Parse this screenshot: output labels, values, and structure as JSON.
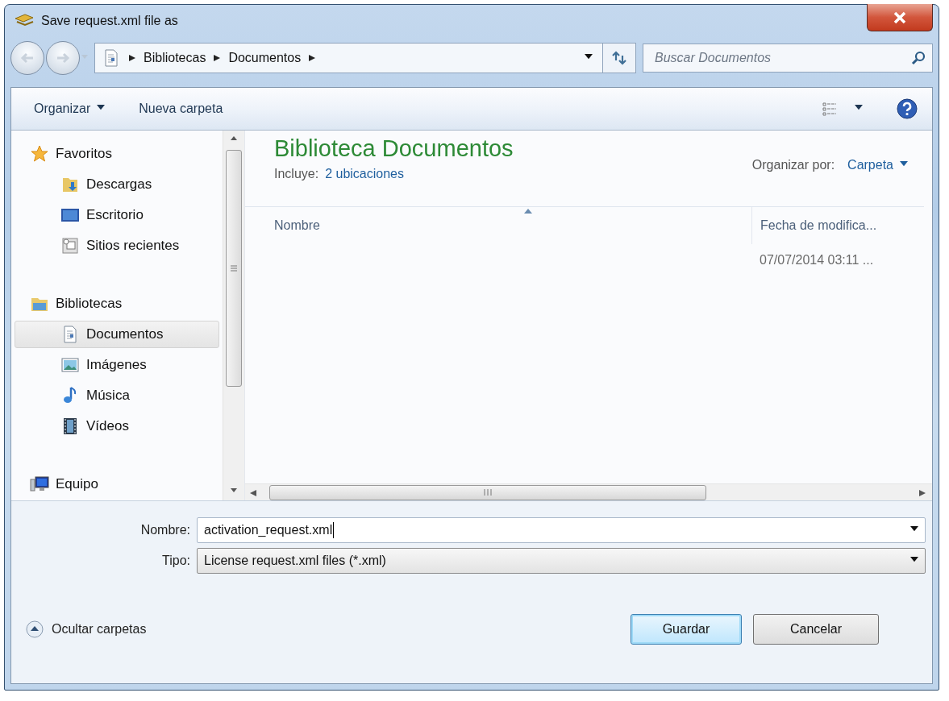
{
  "window": {
    "title": "Save request.xml file as"
  },
  "address": {
    "segments": [
      "Bibliotecas",
      "Documentos"
    ]
  },
  "search": {
    "placeholder": "Buscar Documentos"
  },
  "toolbar": {
    "organize": "Organizar",
    "new_folder": "Nueva carpeta"
  },
  "navigation": [
    {
      "label": "Favoritos",
      "kind": "star",
      "children": [
        {
          "label": "Descargas",
          "kind": "downloads",
          "selected": false
        },
        {
          "label": "Escritorio",
          "kind": "desktop",
          "selected": false
        },
        {
          "label": "Sitios recientes",
          "kind": "recent",
          "selected": false
        }
      ]
    },
    {
      "label": "Bibliotecas",
      "kind": "library",
      "children": [
        {
          "label": "Documentos",
          "kind": "document",
          "selected": true
        },
        {
          "label": "Imágenes",
          "kind": "pictures",
          "selected": false
        },
        {
          "label": "Música",
          "kind": "music",
          "selected": false
        },
        {
          "label": "Vídeos",
          "kind": "video",
          "selected": false
        }
      ]
    },
    {
      "label": "Equipo",
      "kind": "computer"
    }
  ],
  "library": {
    "title": "Biblioteca Documentos",
    "includes_label": "Incluye:",
    "includes_link": "2 ubicaciones",
    "arrange_label": "Organizar por:",
    "arrange_value": "Carpeta"
  },
  "table": {
    "columns": [
      "Nombre",
      "Fecha de modifica..."
    ],
    "rows": [
      {
        "date": "07/07/2014 03:11 ..."
      }
    ]
  },
  "form": [
    {
      "label": "Nombre:",
      "value": "activation_request.xml",
      "kind": "input"
    },
    {
      "label": "Tipo:",
      "value": "License request.xml files (*.xml)",
      "kind": "select"
    }
  ],
  "hide_folders": "Ocultar carpetas",
  "buttons": [
    {
      "label": "Guardar",
      "default": true
    },
    {
      "label": "Cancelar",
      "default": false
    }
  ]
}
